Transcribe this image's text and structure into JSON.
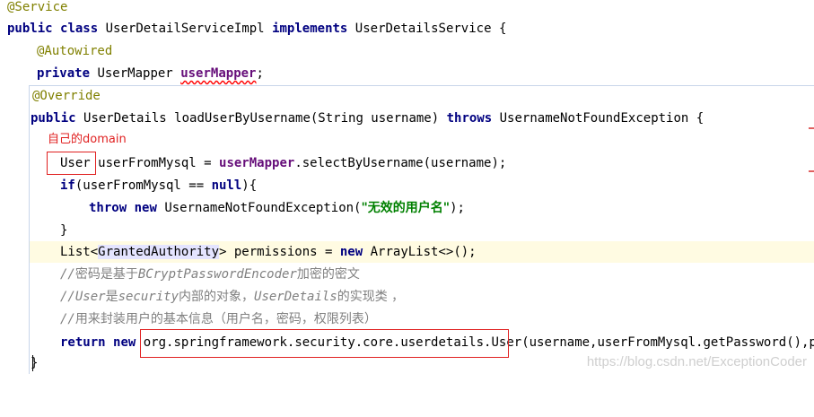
{
  "code": {
    "l1_annotation": "@Service",
    "l2": {
      "kw_public": "public",
      "kw_class": "class",
      "class_name": "UserDetailServiceImpl",
      "kw_implements": "implements",
      "iface": "UserDetailsService",
      "brace": "{"
    },
    "l3_annotation": "@Autowired",
    "l4": {
      "kw_private": "private",
      "type": "UserMapper",
      "field": "userMapper",
      "semi": ";"
    },
    "l5_annotation": "@Override",
    "l6": {
      "kw_public": "public",
      "sig": "UserDetails loadUserByUsername(String username)",
      "kw_throws": "throws",
      "exc": "UsernameNotFoundException {"
    },
    "l7_note": "自己的domain",
    "l8": {
      "type": "User",
      "var": "userFromMysql = ",
      "field": "userMapper",
      "call": ".selectByUsername(username);"
    },
    "l9": {
      "kw_if": "if",
      "cond": "(userFromMysql == ",
      "kw_null": "null",
      "close": "){"
    },
    "l10": {
      "kw_throw": "throw",
      "kw_new": "new",
      "exc": "UsernameNotFoundException(",
      "msg": "\"无效的用户名\"",
      "close": ");"
    },
    "l11_brace": "}",
    "l12": {
      "list": "List<",
      "generic": "GrantedAuthority",
      "rest1": "> permissions = ",
      "kw_new": "new",
      "rest2": "ArrayList<>();"
    },
    "l13": {
      "slashes": "//",
      "t1": "密码是基于",
      "t2": "BCryptPasswordEncoder",
      "t3": "加密的密文"
    },
    "l14": {
      "slashes": "//",
      "t1": "User",
      "t2": "是",
      "t3": "security",
      "t4": "内部的对象，",
      "t5": "UserDetails",
      "t6": "的实现类 ，"
    },
    "l15": {
      "slashes": "//",
      "t1": "用来封装用户的基本信息（用户名，密码，权限列表）"
    },
    "l16": {
      "kw_return": "return",
      "kw_new": "new",
      "fqcn": "org.springframework.security.core.userdetails.User",
      "args": "(username,userFromMysql.getPassword(),permi"
    },
    "l17_brace": "}"
  },
  "watermark": "https://blog.csdn.net/ExceptionCoder",
  "colors": {
    "keyword": "#000080",
    "annotation": "#808000",
    "field": "#660e7a",
    "string": "#008000",
    "comment": "#808080",
    "redbox": "#e02020"
  }
}
